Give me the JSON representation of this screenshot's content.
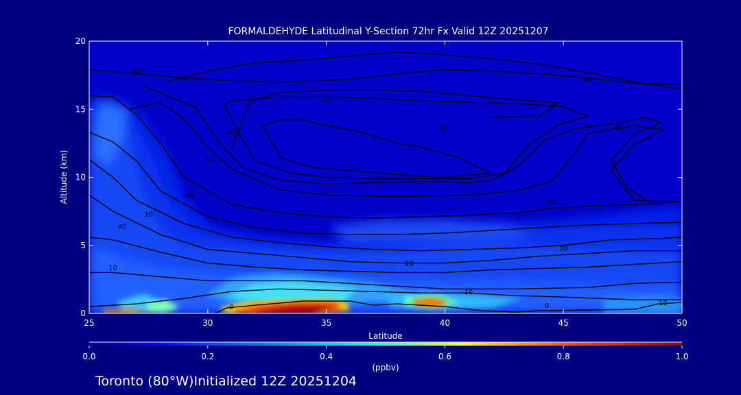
{
  "title": "FORMALDEHYDE Latitudinal Y-Section 72hr  Fx Valid 12Z 20251207",
  "footer": "Toronto (80°W)Initialized 12Z 20251204",
  "colors": {
    "background": "#000080",
    "axes": "#ffffff",
    "contour": "#000000"
  },
  "chart_data": {
    "type": "heatmap",
    "xlabel": "Latitude",
    "ylabel": "Altitude (km)",
    "xlim": [
      25,
      50
    ],
    "ylim": [
      0,
      20
    ],
    "x_ticks": [
      "25",
      "30",
      "35",
      "40",
      "45",
      "50"
    ],
    "y_ticks": [
      "0",
      "5",
      "10",
      "15",
      "20"
    ],
    "colorbar": {
      "label": "(ppbv)",
      "range": [
        0.0,
        1.0
      ],
      "ticks": [
        "0.0",
        "0.2",
        "0.4",
        "0.6",
        "0.8",
        "1.0"
      ],
      "colormap": "jet"
    },
    "contours": {
      "lines": [
        {
          "level": 0,
          "points": [
            [
              30.3,
              0
            ],
            [
              30.8,
              0.4
            ],
            [
              32,
              0.6
            ],
            [
              34,
              0.9
            ],
            [
              36,
              0.9
            ],
            [
              37,
              0.6
            ],
            [
              38,
              0.7
            ],
            [
              40,
              0.5
            ],
            [
              41.5,
              0.2
            ],
            [
              43,
              0.1
            ],
            [
              44,
              0.2
            ],
            [
              48,
              0.3
            ],
            [
              49,
              0.7
            ],
            [
              50,
              0.8
            ]
          ]
        },
        {
          "level": 10,
          "points": [
            [
              25,
              0.5
            ],
            [
              27,
              0.7
            ],
            [
              29,
              1.1
            ],
            [
              31,
              1.6
            ],
            [
              33,
              1.8
            ],
            [
              35,
              1.7
            ],
            [
              37,
              1.6
            ],
            [
              39,
              1.5
            ],
            [
              41,
              1.5
            ],
            [
              43,
              1.3
            ],
            [
              45,
              1.2
            ],
            [
              48,
              1.0
            ],
            [
              50,
              1.0
            ]
          ]
        },
        {
          "level": 10,
          "points": [
            [
              25,
              3.0
            ],
            [
              26,
              3.0
            ],
            [
              28,
              2.7
            ],
            [
              30,
              2.4
            ],
            [
              32,
              2.4
            ],
            [
              34,
              2.4
            ],
            [
              36,
              2.2
            ],
            [
              38,
              2.0
            ],
            [
              40,
              1.8
            ],
            [
              43,
              1.8
            ],
            [
              46,
              1.9
            ],
            [
              48,
              2.2
            ],
            [
              50,
              2.3
            ]
          ]
        },
        {
          "level": 20,
          "points": [
            [
              25,
              5.6
            ],
            [
              26,
              5.4
            ],
            [
              28,
              4.5
            ],
            [
              30,
              3.7
            ],
            [
              32,
              3.4
            ],
            [
              34,
              3.2
            ],
            [
              36,
              3.1
            ],
            [
              38,
              3.0
            ],
            [
              40,
              3.0
            ],
            [
              42,
              3.2
            ],
            [
              44,
              3.3
            ],
            [
              46,
              3.4
            ],
            [
              48,
              3.6
            ],
            [
              50,
              3.8
            ]
          ]
        },
        {
          "level": 20,
          "points": [
            [
              25,
              8.7
            ],
            [
              26,
              7.5
            ],
            [
              28,
              5.8
            ],
            [
              30,
              4.7
            ],
            [
              32,
              4.4
            ],
            [
              34,
              4.1
            ],
            [
              36,
              3.8
            ],
            [
              38,
              3.7
            ],
            [
              40,
              3.7
            ],
            [
              42,
              3.9
            ],
            [
              44,
              4.2
            ],
            [
              46,
              4.4
            ],
            [
              48,
              4.6
            ],
            [
              50,
              4.6
            ]
          ]
        },
        {
          "level": 30,
          "points": [
            [
              25,
              11.3
            ],
            [
              26,
              10.0
            ],
            [
              27,
              8.3
            ],
            [
              29,
              6.6
            ],
            [
              31,
              5.6
            ],
            [
              33,
              5.2
            ],
            [
              35,
              4.9
            ],
            [
              37,
              4.7
            ],
            [
              39,
              4.6
            ],
            [
              41,
              4.7
            ],
            [
              43,
              4.8
            ],
            [
              45,
              5.0
            ],
            [
              47,
              5.4
            ],
            [
              49,
              5.5
            ],
            [
              50,
              5.6
            ]
          ]
        },
        {
          "level": 30,
          "points": [
            [
              25,
              13.3
            ],
            [
              26,
              12.6
            ],
            [
              27,
              11.2
            ],
            [
              28,
              9.0
            ],
            [
              30,
              7.1
            ],
            [
              32,
              6.3
            ],
            [
              34,
              5.9
            ],
            [
              36,
              5.8
            ],
            [
              38,
              5.8
            ],
            [
              40,
              5.9
            ],
            [
              42,
              6.1
            ],
            [
              44,
              6.3
            ],
            [
              46,
              6.5
            ],
            [
              48,
              6.6
            ],
            [
              50,
              6.7
            ]
          ]
        },
        {
          "level": 40,
          "points": [
            [
              25,
              16.0
            ],
            [
              26,
              15.9
            ],
            [
              27,
              14.6
            ],
            [
              28,
              12.5
            ],
            [
              29,
              10.0
            ],
            [
              31,
              8.0
            ],
            [
              33,
              7.4
            ],
            [
              35,
              7.1
            ],
            [
              37,
              7.0
            ],
            [
              39,
              7.1
            ],
            [
              41,
              7.2
            ],
            [
              43,
              7.4
            ],
            [
              45,
              7.8
            ],
            [
              48,
              8.0
            ],
            [
              50,
              8.2
            ]
          ]
        },
        {
          "level": 40,
          "points": [
            [
              26.7,
              15.0
            ],
            [
              28,
              15.5
            ],
            [
              29,
              14.3
            ],
            [
              30,
              12.2
            ],
            [
              31,
              10.6
            ],
            [
              33,
              9.1
            ],
            [
              35,
              8.7
            ],
            [
              37,
              8.6
            ],
            [
              39,
              8.6
            ],
            [
              41,
              8.7
            ],
            [
              43,
              9.0
            ],
            [
              44.5,
              9.7
            ],
            [
              45.5,
              11.8
            ],
            [
              46,
              13.2
            ],
            [
              47,
              13.5
            ],
            [
              48,
              13.8
            ],
            [
              49.2,
              13.5
            ],
            [
              48,
              12.4
            ],
            [
              47,
              10.5
            ],
            [
              48,
              8.3
            ],
            [
              50,
              8.2
            ]
          ]
        },
        {
          "level": 40,
          "points": [
            [
              25,
              17.9
            ],
            [
              27,
              17.6
            ],
            [
              29,
              17.3
            ],
            [
              31,
              17.1
            ],
            [
              33,
              17.0
            ],
            [
              36,
              17.2
            ],
            [
              38,
              17.6
            ],
            [
              40,
              17.9
            ],
            [
              42,
              17.8
            ],
            [
              44,
              17.6
            ],
            [
              46,
              17.3
            ],
            [
              48,
              16.9
            ],
            [
              50,
              16.8
            ]
          ]
        },
        {
          "level": 50,
          "points": [
            [
              27.3,
              16.7
            ],
            [
              28,
              16.2
            ],
            [
              29.5,
              15.1
            ],
            [
              30.5,
              12.5
            ],
            [
              31.5,
              10.7
            ],
            [
              33,
              9.8
            ],
            [
              35,
              9.5
            ],
            [
              37,
              9.6
            ],
            [
              39,
              9.7
            ],
            [
              41,
              9.6
            ],
            [
              42,
              9.8
            ],
            [
              43,
              10.7
            ],
            [
              44.2,
              12.7
            ],
            [
              45.5,
              13.6
            ],
            [
              47,
              13.9
            ],
            [
              48.5,
              14.4
            ],
            [
              49.1,
              14.0
            ],
            [
              48,
              13.2
            ],
            [
              47,
              11.2
            ],
            [
              47.7,
              9.2
            ],
            [
              48.5,
              8.3
            ]
          ]
        },
        {
          "level": 50,
          "points": [
            [
              30.7,
              15.3
            ],
            [
              31.3,
              13.3
            ],
            [
              32,
              11.2
            ],
            [
              33.5,
              10.3
            ],
            [
              35,
              10.0
            ],
            [
              37,
              9.9
            ],
            [
              39,
              9.9
            ],
            [
              41,
              9.9
            ],
            [
              42.5,
              10.3
            ],
            [
              43.5,
              12.3
            ],
            [
              44.7,
              13.8
            ],
            [
              46,
              14.5
            ],
            [
              45,
              15.2
            ],
            [
              43,
              15.4
            ],
            [
              41,
              15.5
            ],
            [
              39,
              15.6
            ],
            [
              37,
              15.8
            ],
            [
              35,
              15.9
            ],
            [
              33,
              15.9
            ],
            [
              31,
              15.6
            ],
            [
              30.7,
              15.3
            ]
          ]
        },
        {
          "level": 50,
          "points": [
            [
              28.2,
              17.0
            ],
            [
              30,
              17.8
            ],
            [
              32,
              18.4
            ],
            [
              34,
              18.6
            ],
            [
              36,
              18.9
            ],
            [
              38,
              19.2
            ],
            [
              40,
              19.0
            ],
            [
              42,
              18.7
            ],
            [
              44,
              18.3
            ],
            [
              46,
              17.7
            ],
            [
              48,
              17.0
            ],
            [
              50,
              16.5
            ]
          ]
        },
        {
          "level": 60,
          "points": [
            [
              32.3,
              13.8
            ],
            [
              33.1,
              11.4
            ],
            [
              34.5,
              10.7
            ],
            [
              36,
              10.5
            ],
            [
              38,
              10.2
            ],
            [
              40,
              10.0
            ],
            [
              41.9,
              10.3
            ],
            [
              40.5,
              11.5
            ],
            [
              39,
              12.2
            ],
            [
              38,
              12.5
            ],
            [
              36.5,
              13.3
            ],
            [
              35,
              13.8
            ],
            [
              34,
              14.2
            ],
            [
              33,
              14.2
            ],
            [
              32.3,
              13.8
            ]
          ]
        },
        {
          "level": 60,
          "points": [
            [
              31,
              12.2
            ],
            [
              31.8,
              15.6
            ],
            [
              33,
              16.2
            ],
            [
              35,
              16.4
            ],
            [
              37,
              16.4
            ],
            [
              39,
              16.3
            ],
            [
              41,
              16.0
            ],
            [
              43,
              15.7
            ],
            [
              44.8,
              15.5
            ],
            [
              44,
              14.5
            ],
            [
              42,
              14.4
            ]
          ]
        }
      ],
      "labels": [
        {
          "text": "0",
          "x": 31.0,
          "y": 0.5
        },
        {
          "text": "0",
          "x": 44.3,
          "y": 0.6
        },
        {
          "text": "10",
          "x": 26.0,
          "y": 3.4
        },
        {
          "text": "10",
          "x": 41.0,
          "y": 1.6
        },
        {
          "text": "10",
          "x": 49.2,
          "y": 0.8
        },
        {
          "text": "20",
          "x": 38.5,
          "y": 3.7
        },
        {
          "text": "30",
          "x": 45.0,
          "y": 4.8
        },
        {
          "text": "30",
          "x": 27.5,
          "y": 7.3
        },
        {
          "text": "40",
          "x": 29.2,
          "y": 8.7
        },
        {
          "text": "40",
          "x": 26.4,
          "y": 6.4
        },
        {
          "text": "40",
          "x": 35.0,
          "y": 15.7
        },
        {
          "text": "40",
          "x": 47.3,
          "y": 13.7
        },
        {
          "text": "40",
          "x": 27.0,
          "y": 17.8
        },
        {
          "text": "50",
          "x": 29.0,
          "y": 17.3
        },
        {
          "text": "50",
          "x": 44.5,
          "y": 8.2
        },
        {
          "text": "50",
          "x": 30.1,
          "y": 11.3
        },
        {
          "text": "50",
          "x": 40.0,
          "y": 13.6
        },
        {
          "text": "50",
          "x": 46.0,
          "y": 17.2
        },
        {
          "text": "60",
          "x": 31.0,
          "y": 13.3
        }
      ]
    }
  }
}
